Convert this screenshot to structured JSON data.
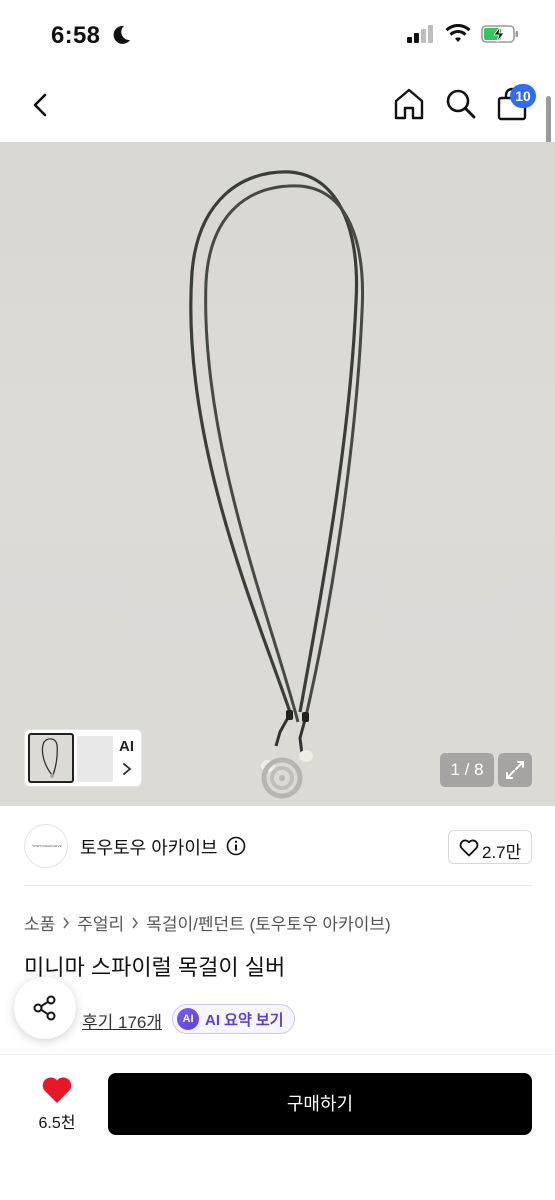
{
  "status_bar": {
    "time": "6:58"
  },
  "nav": {
    "cart_count": "10"
  },
  "gallery": {
    "counter": "1 / 8",
    "ai_label": "AI"
  },
  "seller": {
    "name": "토우토우 아카이브",
    "logo_text": "TOWTOWARCHIVE",
    "likes": "2.7만"
  },
  "breadcrumb": {
    "items": [
      "소품",
      "주얼리",
      "목걸이/펜던트 (토우토우 아카이브)"
    ]
  },
  "product": {
    "title": "미니마 스파이럴 목걸이 실버"
  },
  "reviews": {
    "label": "후기 176개"
  },
  "ai_summary": {
    "badge": "AI",
    "label": "AI 요약 보기"
  },
  "bottom": {
    "wish_count": "6.5천",
    "buy_label": "구매하기"
  },
  "colors": {
    "accent": "#2f6bff",
    "heart": "#e5182a",
    "ai": "#5a3fd6"
  }
}
